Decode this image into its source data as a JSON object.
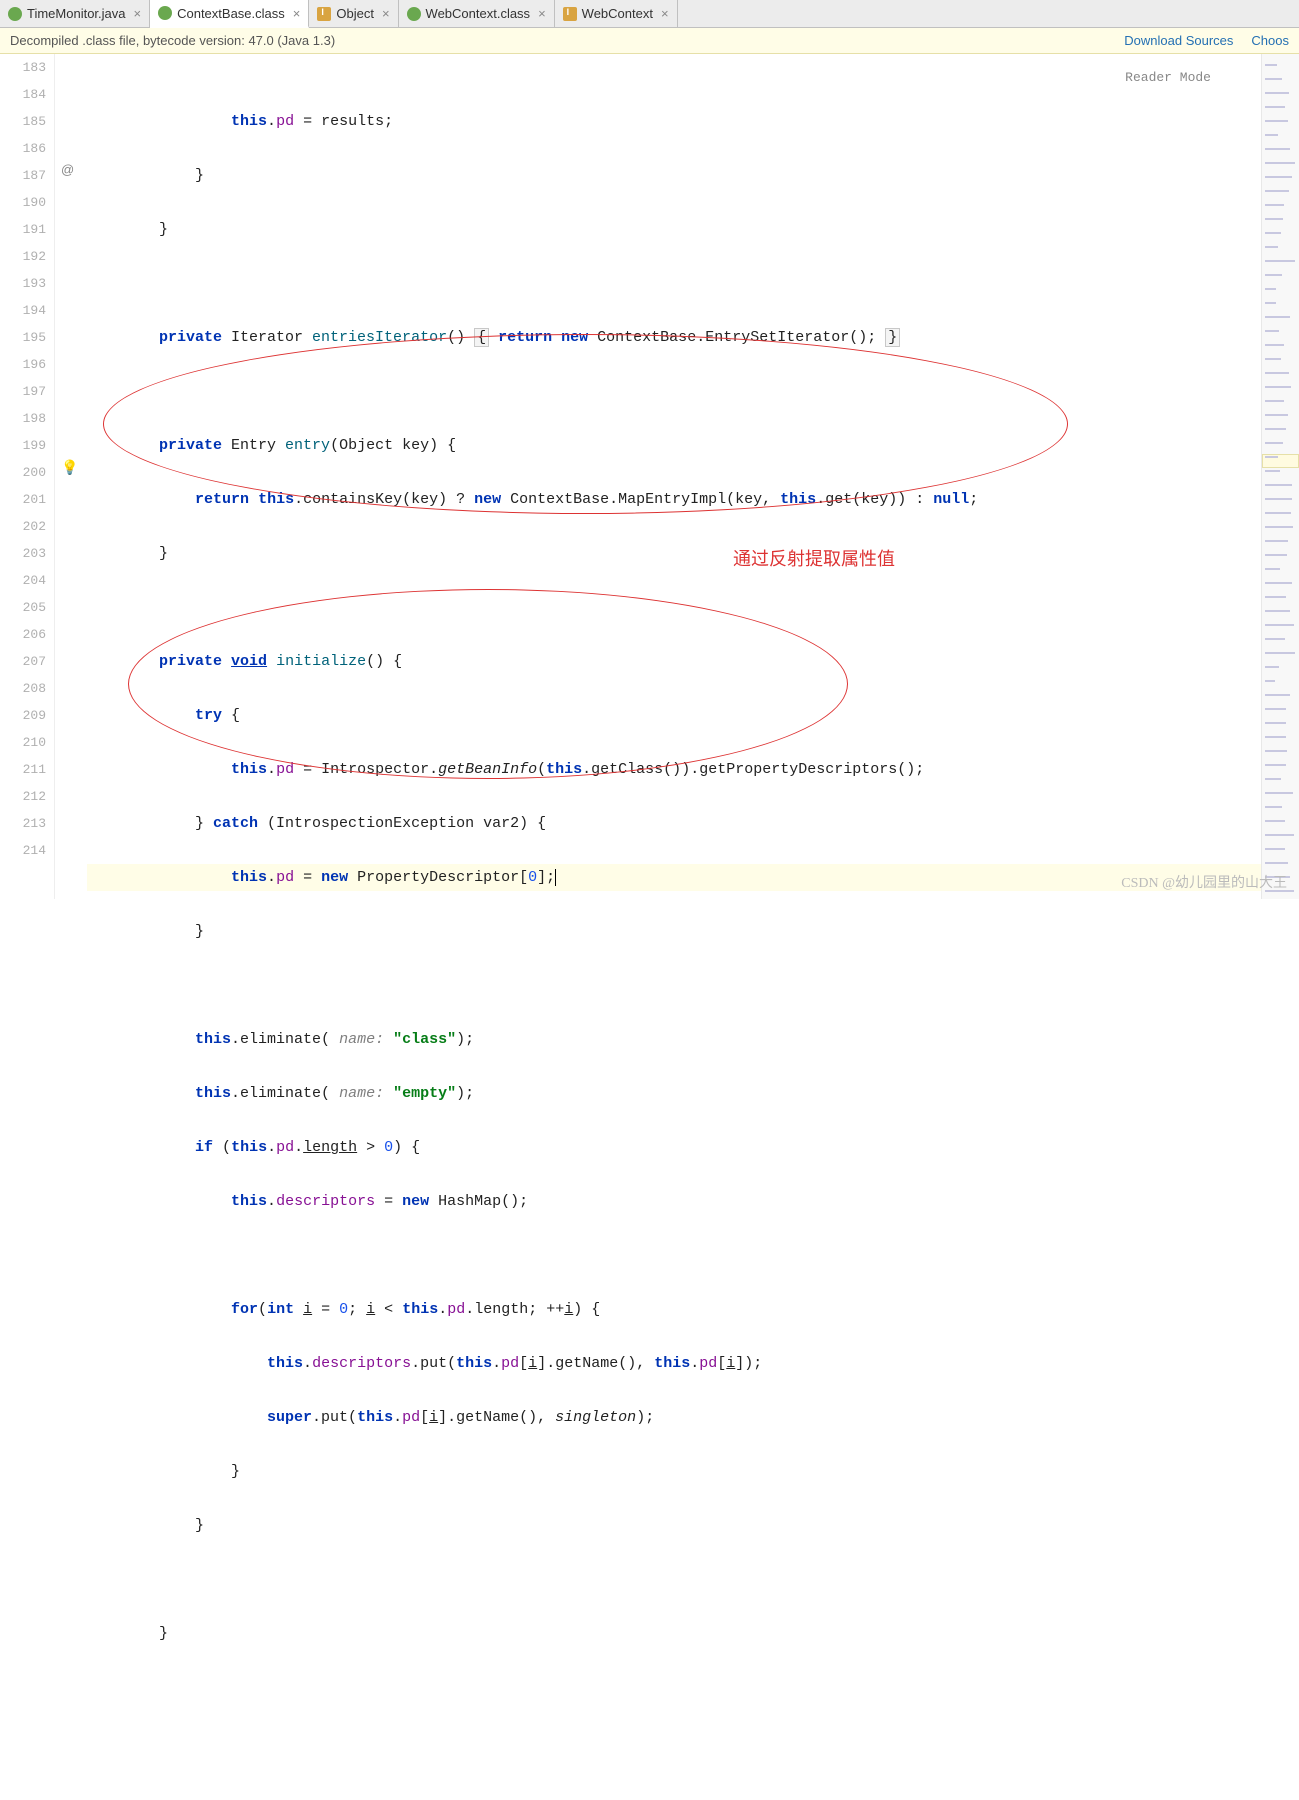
{
  "tabs": [
    {
      "label": "TimeMonitor.java",
      "icon": "c"
    },
    {
      "label": "ContextBase.class",
      "icon": "c",
      "active": true
    },
    {
      "label": "Object",
      "icon": "i"
    },
    {
      "label": "WebContext.class",
      "icon": "c"
    },
    {
      "label": "WebContext",
      "icon": "i"
    }
  ],
  "banner": {
    "text": "Decompiled .class file, bytecode version: 47.0 (Java 1.3)",
    "link1": "Download Sources",
    "link2": "Choos"
  },
  "reader_mode": "Reader Mode",
  "line_numbers": [
    "183",
    "184",
    "185",
    "186",
    "187",
    "190",
    "191",
    "192",
    "193",
    "194",
    "195",
    "196",
    "197",
    "198",
    "199",
    "200",
    "201",
    "202",
    "203",
    "204",
    "205",
    "206",
    "207",
    "208",
    "209",
    "210",
    "211",
    "212",
    "213",
    "214"
  ],
  "code": {
    "l183_a": "                ",
    "l183_this": "this",
    "l183_b": ".",
    "l183_pd": "pd",
    "l183_c": " = results;",
    "l184": "            }",
    "l185": "        }",
    "l186": "",
    "l187_a": "        ",
    "l187_private": "private",
    "l187_b": " Iterator ",
    "l187_method": "entriesIterator",
    "l187_c": "() ",
    "l187_lb": "{",
    "l187_d": " ",
    "l187_return": "return",
    "l187_e": " ",
    "l187_new": "new",
    "l187_f": " ContextBase.EntrySetIterator(); ",
    "l187_rb": "}",
    "l190": "",
    "l191_a": "        ",
    "l191_private": "private",
    "l191_b": " Entry ",
    "l191_method": "entry",
    "l191_c": "(Object key) {",
    "l192_a": "            ",
    "l192_return": "return",
    "l192_b": " ",
    "l192_this": "this",
    "l192_c": ".containsKey(key) ? ",
    "l192_new": "new",
    "l192_d": " ContextBase.MapEntryImpl(key, ",
    "l192_this2": "this",
    "l192_e": ".get(key)) : ",
    "l192_null": "null",
    "l192_f": ";",
    "l193": "        }",
    "l194": "",
    "l195_a": "        ",
    "l195_private": "private",
    "l195_b": " ",
    "l195_void": "void",
    "l195_c": " ",
    "l195_method": "initialize",
    "l195_d": "() {",
    "l196_a": "            ",
    "l196_try": "try",
    "l196_b": " {",
    "l197_a": "                ",
    "l197_this": "this",
    "l197_b": ".",
    "l197_pd": "pd",
    "l197_c": " = Introspector.",
    "l197_m1": "getBeanInfo",
    "l197_d": "(",
    "l197_this2": "this",
    "l197_e": ".getClass()).getPropertyDescriptors();",
    "l198_a": "            } ",
    "l198_catch": "catch",
    "l198_b": " (IntrospectionException var2) {",
    "l199_a": "                ",
    "l199_this": "this",
    "l199_b": ".",
    "l199_pd": "pd",
    "l199_c": " = ",
    "l199_new": "new",
    "l199_d": " PropertyDescriptor[",
    "l199_zero": "0",
    "l199_e": "];",
    "l200": "            }",
    "l201": "",
    "l202_a": "            ",
    "l202_this": "this",
    "l202_b": ".eliminate( ",
    "l202_p": "name:",
    "l202_c": " ",
    "l202_str": "\"class\"",
    "l202_d": ");",
    "l203_a": "            ",
    "l203_this": "this",
    "l203_b": ".eliminate( ",
    "l203_p": "name:",
    "l203_c": " ",
    "l203_str": "\"empty\"",
    "l203_d": ");",
    "l204_a": "            ",
    "l204_if": "if",
    "l204_b": " (",
    "l204_this": "this",
    "l204_c": ".",
    "l204_pd": "pd",
    "l204_d": ".",
    "l204_len": "length",
    "l204_e": " > ",
    "l204_zero": "0",
    "l204_f": ") {",
    "l205_a": "                ",
    "l205_this": "this",
    "l205_b": ".",
    "l205_desc": "descriptors",
    "l205_c": " = ",
    "l205_new": "new",
    "l205_d": " HashMap();",
    "l206": "",
    "l207_a": "                ",
    "l207_for": "for",
    "l207_b": "(",
    "l207_int": "int",
    "l207_c": " ",
    "l207_i": "i",
    "l207_d": " = ",
    "l207_zero": "0",
    "l207_e": "; ",
    "l207_i2": "i",
    "l207_f": " < ",
    "l207_this": "this",
    "l207_g": ".",
    "l207_pd": "pd",
    "l207_h": ".length; ++",
    "l207_i3": "i",
    "l207_j": ") {",
    "l208_a": "                    ",
    "l208_this": "this",
    "l208_b": ".",
    "l208_desc": "descriptors",
    "l208_c": ".put(",
    "l208_this2": "this",
    "l208_d": ".",
    "l208_pd": "pd",
    "l208_e": "[",
    "l208_i": "i",
    "l208_f": "].getName(), ",
    "l208_this3": "this",
    "l208_g": ".",
    "l208_pd2": "pd",
    "l208_h": "[",
    "l208_i2": "i",
    "l208_j": "]);",
    "l209_a": "                    ",
    "l209_super": "super",
    "l209_b": ".put(",
    "l209_this": "this",
    "l209_c": ".",
    "l209_pd": "pd",
    "l209_d": "[",
    "l209_i": "i",
    "l209_e": "].getName(), ",
    "l209_sing": "singleton",
    "l209_f": ");",
    "l210": "                }",
    "l211": "            }",
    "l212": "",
    "l213": "        }",
    "l214": ""
  },
  "annotation_text": "通过反射提取属性值",
  "watermark": "CSDN @幼儿园里的山大王"
}
